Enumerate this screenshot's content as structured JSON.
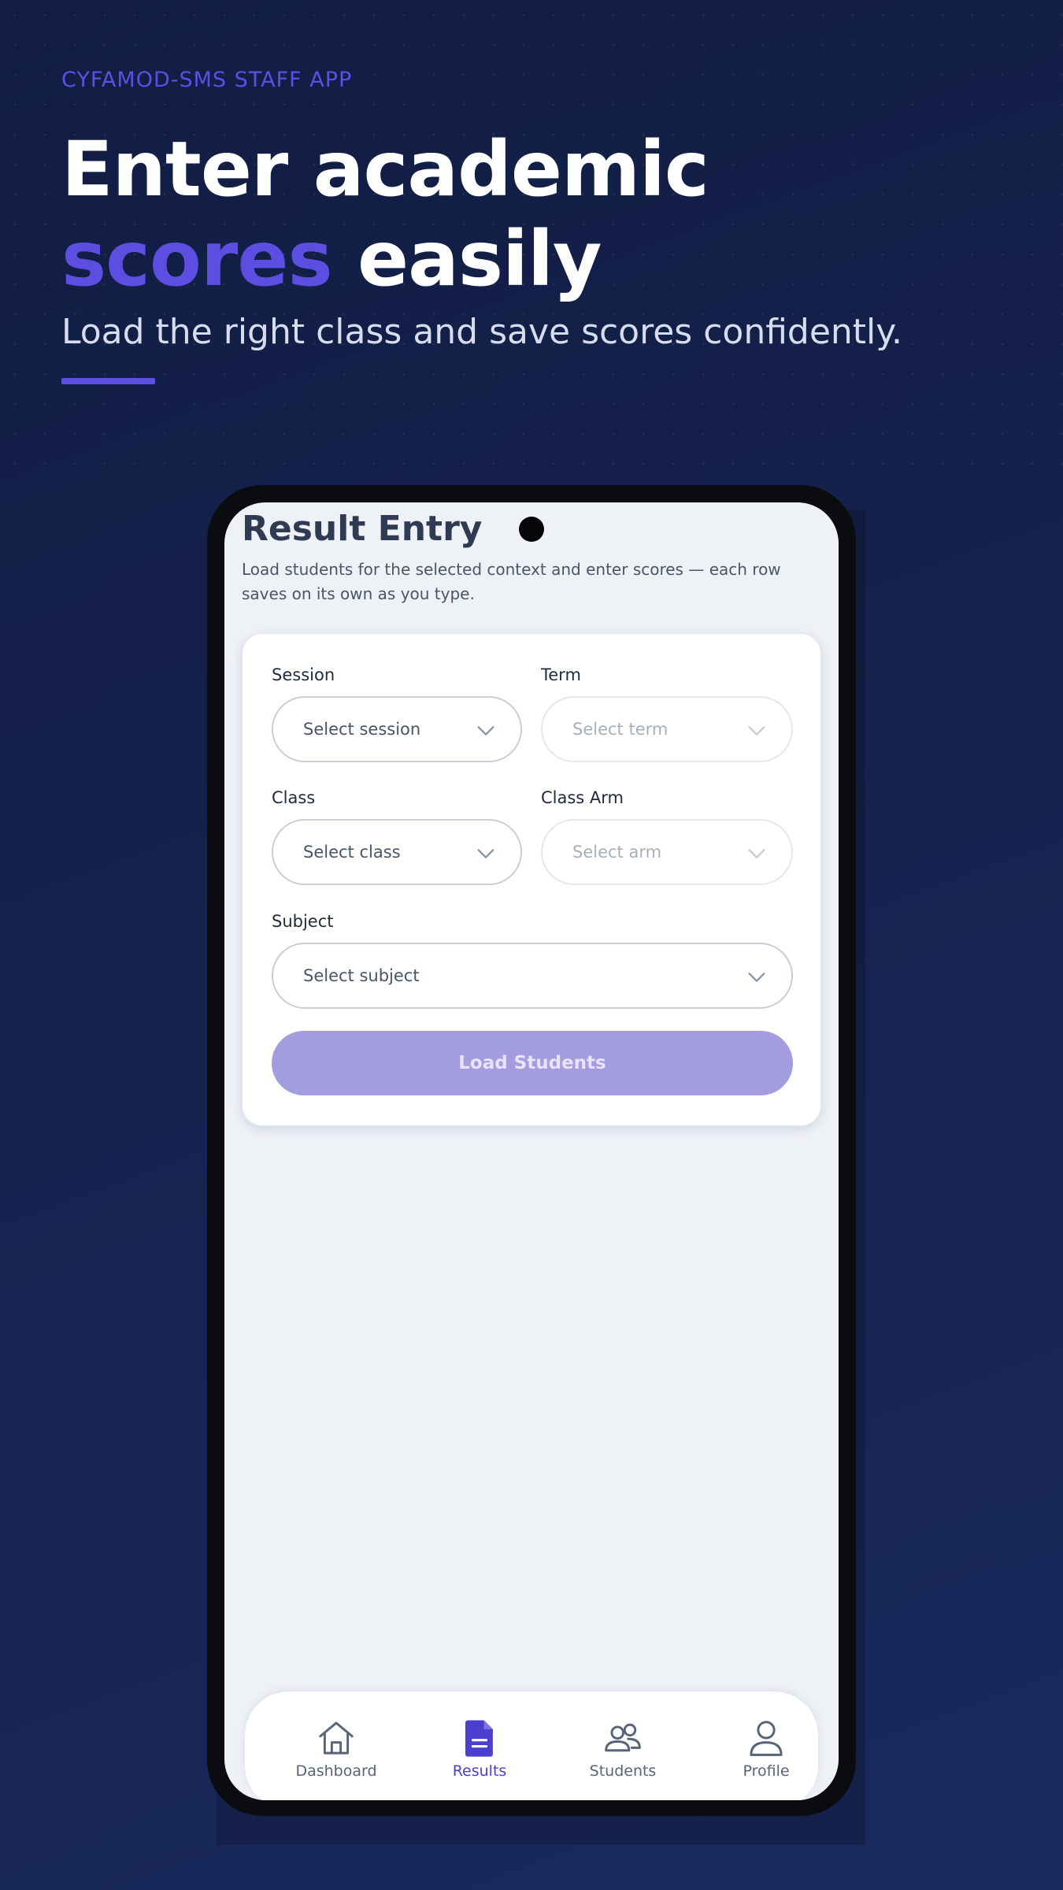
{
  "promo": {
    "eyebrow": "CYFAMOD-SMS STAFF APP",
    "headline_line1": "Enter academic",
    "headline_accent": "scores",
    "headline_rest": " easily",
    "subline": "Load the right class and save scores confidently.",
    "accent_color": "#5b4ee0"
  },
  "screen": {
    "title": "Result Entry",
    "description": "Load students for the selected context and enter scores — each row saves on its own as you type."
  },
  "form": {
    "session": {
      "label": "Session",
      "placeholder": "Select session",
      "enabled": true
    },
    "term": {
      "label": "Term",
      "placeholder": "Select term",
      "enabled": false
    },
    "class": {
      "label": "Class",
      "placeholder": "Select class",
      "enabled": true
    },
    "class_arm": {
      "label": "Class Arm",
      "placeholder": "Select arm",
      "enabled": false
    },
    "subject": {
      "label": "Subject",
      "placeholder": "Select subject",
      "enabled": true
    },
    "load_button": "Load Students"
  },
  "nav": {
    "items": [
      {
        "label": "Dashboard",
        "icon": "home-icon",
        "active": false
      },
      {
        "label": "Results",
        "icon": "document-icon",
        "active": true
      },
      {
        "label": "Students",
        "icon": "users-icon",
        "active": false
      },
      {
        "label": "Profile",
        "icon": "user-icon",
        "active": false
      }
    ]
  }
}
